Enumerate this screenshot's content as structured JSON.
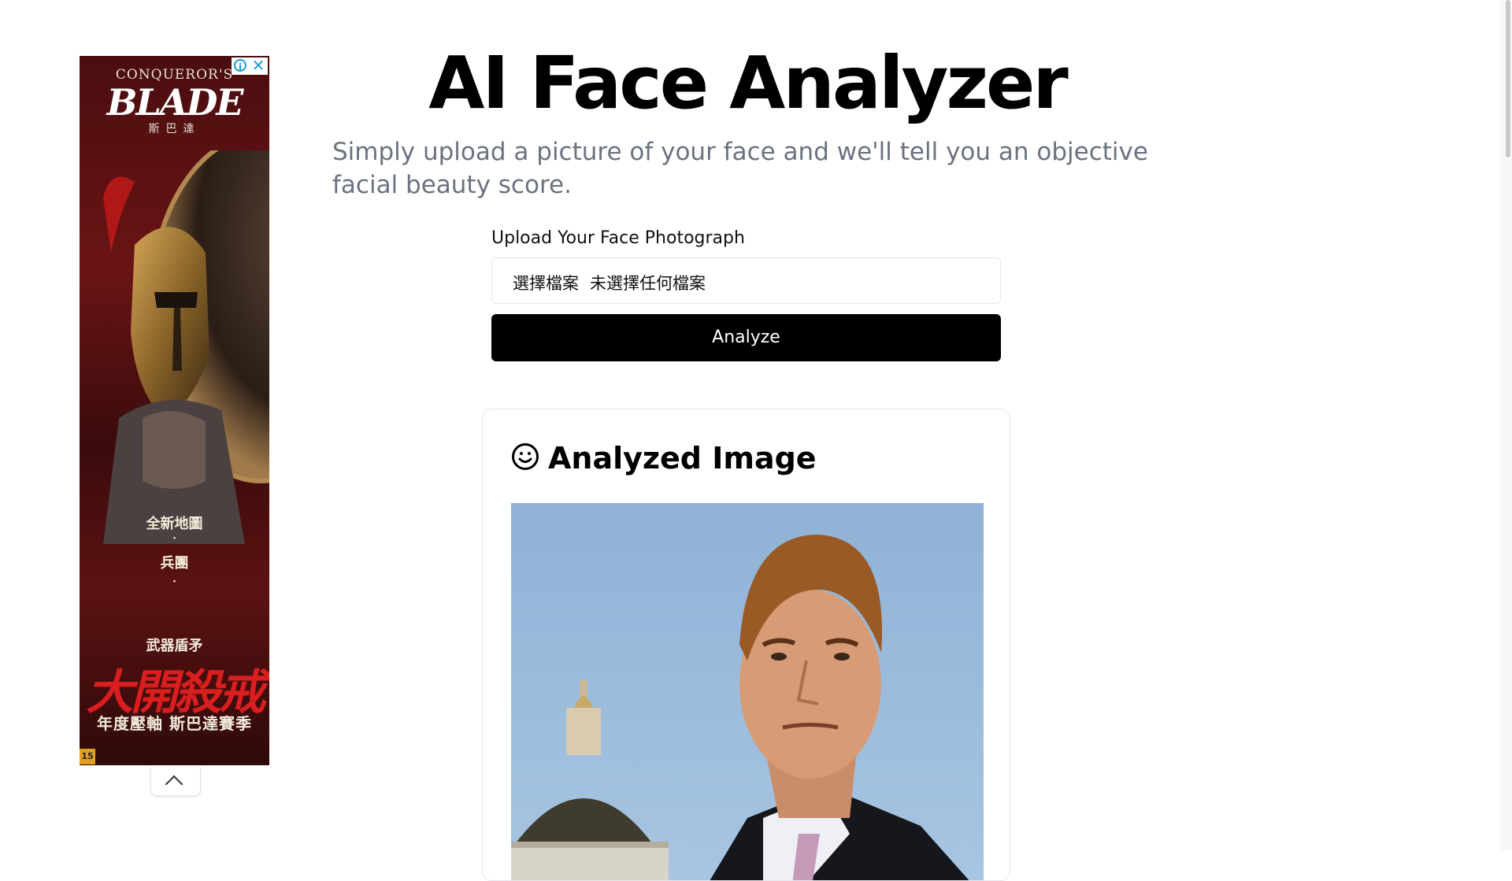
{
  "ad": {
    "logo_top": "CONQUEROR'S",
    "logo_main": "BLADE",
    "logo_sub": "斯巴達",
    "line1": "全新地圖",
    "dot": "·",
    "line2": "兵團",
    "line3": "武器盾矛",
    "headline": "大開殺戒",
    "tagline": "年度壓軸 斯巴達賽季",
    "rating": "15",
    "info_icon": "info-icon",
    "close_icon": "close-icon",
    "collapse_icon": "chevron-up-icon"
  },
  "header": {
    "title": "AI Face Analyzer",
    "subtitle": "Simply upload a picture of your face and we'll tell you an objective facial beauty score."
  },
  "upload": {
    "label": "Upload Your Face Photograph",
    "choose_file": "選擇檔案",
    "no_file": "未選擇任何檔案",
    "analyze_label": "Analyze"
  },
  "result": {
    "title": "Analyzed Image",
    "icon": "smile-icon"
  }
}
